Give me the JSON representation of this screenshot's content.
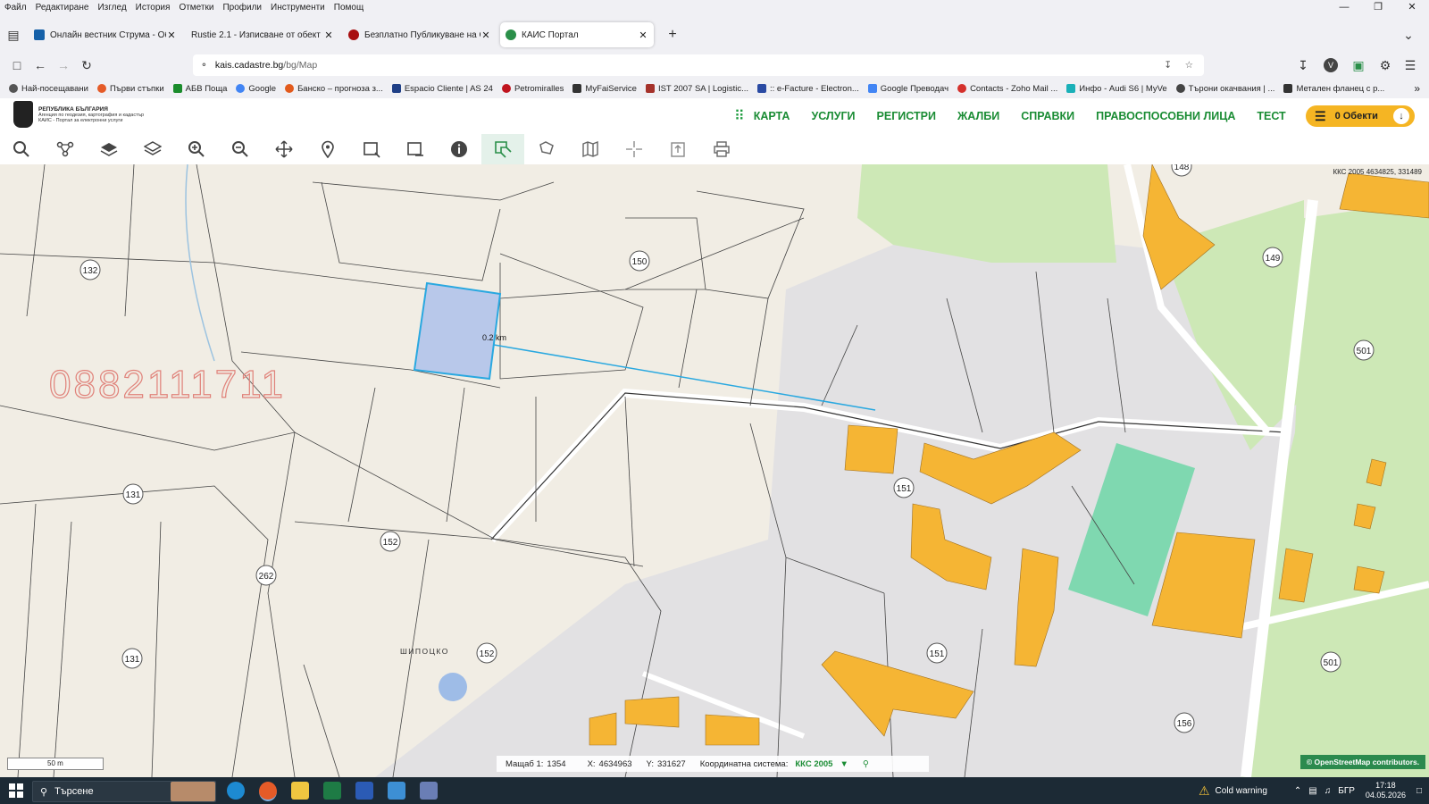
{
  "menu": [
    "Файл",
    "Редактиране",
    "Изглед",
    "История",
    "Отметки",
    "Профили",
    "Инструменти",
    "Помощ"
  ],
  "tabs": [
    {
      "title": "Онлайн вестник Струма - Общест",
      "color": "#1560a8"
    },
    {
      "title": "Rustie 2.1 - Изписване от обект",
      "color": "#ffffff"
    },
    {
      "title": "Безплатно Публикуване на Обяви",
      "color": "#a80f10"
    },
    {
      "title": "КАИС Портал",
      "color": "#2a8f49",
      "active": true
    }
  ],
  "url": {
    "host": "kais.cadastre.bg",
    "path": "/bg/Map"
  },
  "bookmarks": [
    {
      "label": "Най-посещавани",
      "color": "#555"
    },
    {
      "label": "Първи стъпки",
      "color": "#e55b28"
    },
    {
      "label": "АБВ Поща",
      "color": "#1b8c2c"
    },
    {
      "label": "Google",
      "color": "#4285f4"
    },
    {
      "label": "Банско – прогноза з...",
      "color": "#e25a1c"
    },
    {
      "label": "Espacio Cliente | AS 24",
      "color": "#1f3f86"
    },
    {
      "label": "Petromiralles",
      "color": "#c0141e"
    },
    {
      "label": "MyFaiService",
      "color": "#333"
    },
    {
      "label": "IST 2007 SA | Logistic...",
      "color": "#a5322b"
    },
    {
      "label": ":: e-Facture - Electron...",
      "color": "#2a4aa3"
    },
    {
      "label": "Google Преводач",
      "color": "#4285f4"
    },
    {
      "label": "Contacts - Zoho Mail ...",
      "color": "#d4302c"
    },
    {
      "label": "Инфо - Audi S6 | MyVe",
      "color": "#1ab0b8"
    },
    {
      "label": "Търони окачвания | ...",
      "color": "#444"
    },
    {
      "label": "Метален фланец с р...",
      "color": "#333"
    }
  ],
  "site": {
    "org_line1": "РЕПУБЛИКА БЪЛГАРИЯ",
    "org_line2": "Агенция по геодезия, картография и кадастър",
    "org_line3": "КАИС - Портал за електронни услуги",
    "nav": [
      "КАРТА",
      "УСЛУГИ",
      "РЕГИСТРИ",
      "ЖАЛБИ",
      "СПРАВКИ",
      "ПРАВОСПОСОБНИ ЛИЦА",
      "ТЕСТ"
    ],
    "objects_button": "0 Обекти"
  },
  "toolbar_tools": [
    "search-tool",
    "route-tool",
    "layers-tool",
    "layers-alt-tool",
    "zoom-in-tool",
    "zoom-out-tool",
    "pan-tool",
    "marker-tool",
    "select-rect-tool",
    "deselect-rect-tool",
    "info-tool",
    "measure-tool",
    "draw-tool",
    "map-tool",
    "crosshair-tool",
    "export-tool",
    "print-tool"
  ],
  "map": {
    "watermark": "0882111711",
    "coord_tag": "ККС 2005 4634825, 331489",
    "measure_label": "0.2 km",
    "place_name": "ШИПОЦКО",
    "cad_numbers": [
      "132",
      "150",
      "148",
      "149",
      "501",
      "131",
      "152",
      "151",
      "262",
      "131",
      "152",
      "151",
      "156",
      "501"
    ],
    "scale_label": "50 m",
    "scale": {
      "label": "Мащаб 1:",
      "value": "1354"
    },
    "x": {
      "label": "X:",
      "value": "4634963"
    },
    "y": {
      "label": "Y:",
      "value": "331627"
    },
    "crs": {
      "label": "Координатна система:",
      "value": "ККС 2005"
    },
    "attribution": "© OpenStreetMap contributors."
  },
  "taskbar": {
    "search_placeholder": "Търсене",
    "weather": "Cold warning",
    "lang": "БГР",
    "time": "17:18",
    "date": "04.05.2026"
  }
}
